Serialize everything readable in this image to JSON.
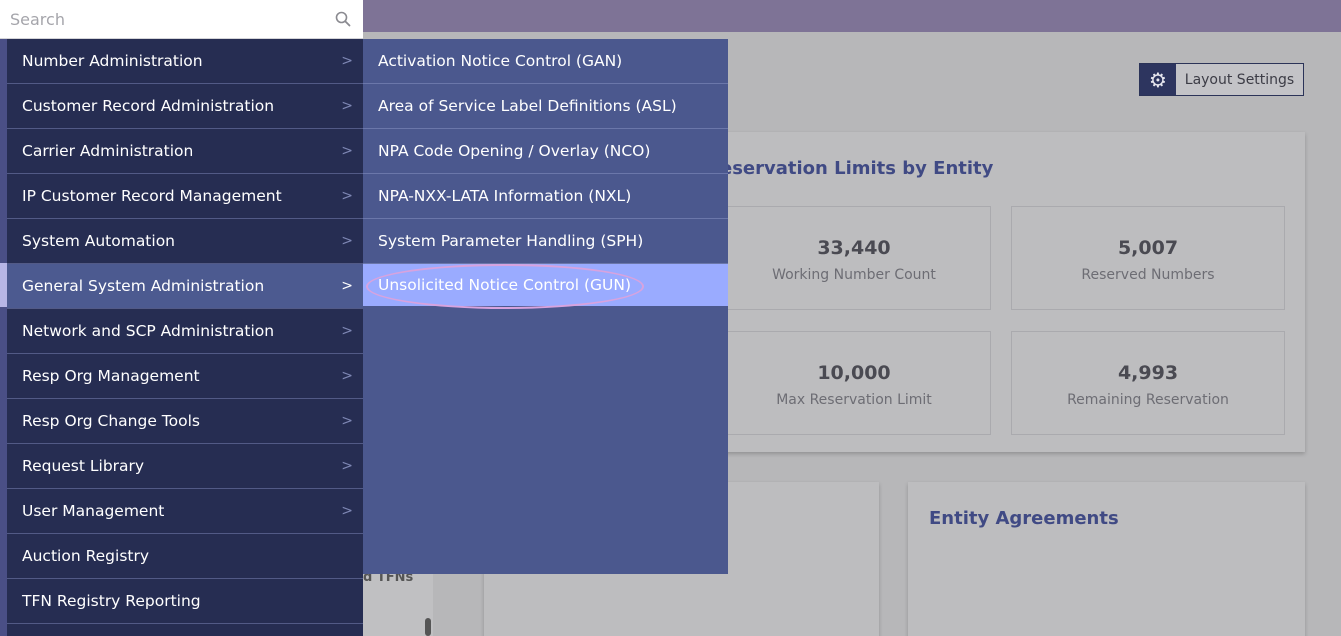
{
  "search": {
    "placeholder": "Search"
  },
  "menu": {
    "items": [
      {
        "label": "Number Administration",
        "has_submenu": true
      },
      {
        "label": "Customer Record Administration",
        "has_submenu": true
      },
      {
        "label": "Carrier Administration",
        "has_submenu": true
      },
      {
        "label": "IP Customer Record Management",
        "has_submenu": true
      },
      {
        "label": "System Automation",
        "has_submenu": true
      },
      {
        "label": "General System Administration",
        "has_submenu": true,
        "active": true
      },
      {
        "label": "Network and SCP Administration",
        "has_submenu": true
      },
      {
        "label": "Resp Org Management",
        "has_submenu": true
      },
      {
        "label": "Resp Org Change Tools",
        "has_submenu": true
      },
      {
        "label": "Request Library",
        "has_submenu": true
      },
      {
        "label": "User Management",
        "has_submenu": true
      },
      {
        "label": "Auction Registry",
        "has_submenu": false
      },
      {
        "label": "TFN Registry Reporting",
        "has_submenu": false
      }
    ],
    "chevron": ">"
  },
  "submenu": {
    "items": [
      {
        "label": "Activation Notice Control (GAN)"
      },
      {
        "label": "Area of Service Label Definitions (ASL)"
      },
      {
        "label": "NPA Code Opening / Overlay (NCO)"
      },
      {
        "label": "NPA-NXX-LATA Information (NXL)"
      },
      {
        "label": "System Parameter Handling (SPH)"
      },
      {
        "label": "Unsolicited Notice Control (GUN)",
        "active": true
      }
    ]
  },
  "background": {
    "layout_settings": "Layout Settings",
    "reservation_title": "eservation Limits by Entity",
    "tiles": [
      {
        "value": "33,440",
        "label": "Working Number Count"
      },
      {
        "value": "5,007",
        "label": "Reserved Numbers"
      },
      {
        "value": "10,000",
        "label": "Max Reservation Limit"
      },
      {
        "value": "4,993",
        "label": "Remaining Reservation"
      }
    ],
    "entity_agreements": "Entity Agreements",
    "partial_tfns": "d TFNs"
  },
  "colors": {
    "menu_bg": "#262d52",
    "submenu_bg": "#4b588e",
    "active_sub": "#9aabff",
    "accent_title": "#404a84"
  }
}
